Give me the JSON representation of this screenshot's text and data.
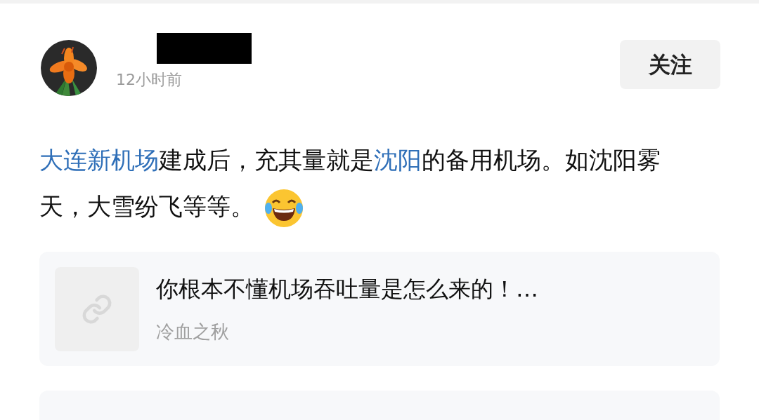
{
  "author": {
    "time": "12小时前"
  },
  "follow_button": "关注",
  "post": {
    "segments": [
      {
        "kind": "link",
        "text": "大连新机场"
      },
      {
        "kind": "text",
        "text": "建成后，充其量就是"
      },
      {
        "kind": "link",
        "text": "沈阳"
      },
      {
        "kind": "text",
        "text": "的备用机场。如沈阳雾天，大雪纷飞等等。"
      }
    ]
  },
  "shared_link": {
    "title": "你根本不懂机场吞吐量是怎么来的！…",
    "source": "冷血之秋"
  }
}
